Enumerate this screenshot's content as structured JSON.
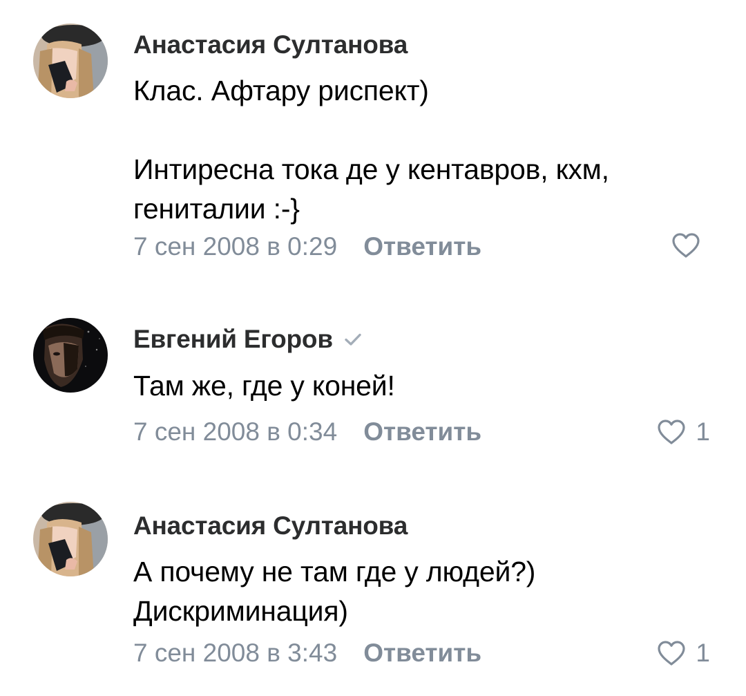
{
  "comments": [
    {
      "author": "Анастасия Султанова",
      "verified": false,
      "lines": [
        "Клас. Афтару риспект)",
        "",
        "Интиресна тока де у кентавров, кхм,",
        "гениталии :-}"
      ],
      "date": "7 сен 2008 в 0:29",
      "reply_label": "Ответить",
      "likes": ""
    },
    {
      "author": "Евгений Егоров",
      "verified": true,
      "lines": [
        "Там же, где у коней!"
      ],
      "date": "7 сен 2008 в 0:34",
      "reply_label": "Ответить",
      "likes": "1"
    },
    {
      "author": "Анастасия Султанова",
      "verified": false,
      "lines": [
        "А почему не там где у людей?)",
        "Дискриминация)"
      ],
      "date": "7 сен 2008 в 3:43",
      "reply_label": "Ответить",
      "likes": "1"
    }
  ],
  "icons": {
    "like": "heart-outline-icon",
    "verified": "checkmark-icon"
  },
  "colors": {
    "secondary_text": "#818c99",
    "author_text": "#2c2d2e",
    "body_text": "#000000"
  }
}
